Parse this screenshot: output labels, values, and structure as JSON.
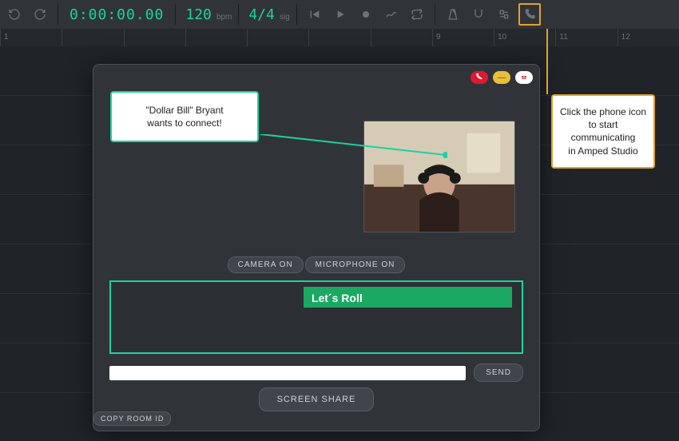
{
  "transport": {
    "time": "0:00:00.00",
    "tempo": "120",
    "tempo_label": "bpm",
    "signature": "4/4",
    "signature_label": "sig"
  },
  "ruler": {
    "ticks": [
      "1",
      "",
      "",
      "",
      "",
      "",
      "",
      "9",
      "10",
      "11",
      "12"
    ]
  },
  "comm": {
    "camera_btn": "CAMERA ON",
    "mic_btn": "MICROPHONE ON",
    "chat_message": "Let´s Roll",
    "send_btn": "SEND",
    "screen_share_btn": "SCREEN SHARE",
    "copy_room_btn": "COPY ROOM ID"
  },
  "callouts": {
    "connect_line1": "\"Dollar Bill\" Bryant",
    "connect_line2": "wants to connect!",
    "tip_line1": "Click the phone icon",
    "tip_line2": "to start",
    "tip_line3": "communicating",
    "tip_line4": "in Amped Studio"
  },
  "colors": {
    "accent": "#1dd1a1",
    "highlight": "#e2a22e",
    "green_button": "#1aa863",
    "red": "#e01830"
  }
}
